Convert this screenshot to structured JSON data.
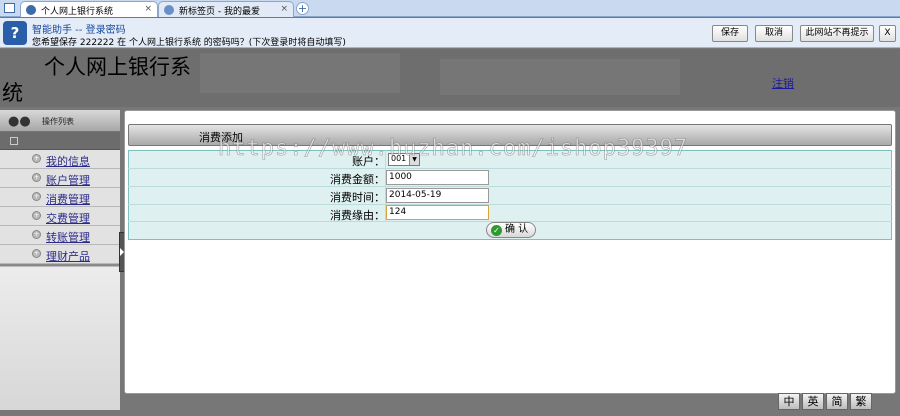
{
  "tabs": [
    {
      "label": "个人网上银行系统",
      "close": "×"
    },
    {
      "label": "新标签页 - 我的最爱",
      "close": "×"
    }
  ],
  "newtab": "+",
  "infobar": {
    "title": "智能助手 -- 登录密码",
    "message": "您希望保存 222222 在 个人网上银行系统 的密码吗？(下次登录时将自动填写)",
    "buttons": {
      "save": "保存",
      "cancel": "取消",
      "never": "此网站不再提示",
      "close": "X"
    }
  },
  "header": {
    "title_line1": "个人网上银行系",
    "title_line2": "统",
    "logout": "注销"
  },
  "sidebar": {
    "header": "操作列表",
    "items": [
      {
        "label": "我的信息"
      },
      {
        "label": "账户管理"
      },
      {
        "label": "消费管理"
      },
      {
        "label": "交费管理"
      },
      {
        "label": "转账管理"
      },
      {
        "label": "理财产品"
      }
    ]
  },
  "panel": {
    "title": "消费添加"
  },
  "form": {
    "account_label": "账户：",
    "account_value": "001",
    "amount_label": "消费金额：",
    "amount_value": "1000",
    "time_label": "消费时间：",
    "time_value": "2014-05-19",
    "reason_label": "消费缘由：",
    "reason_value": "124",
    "confirm": "确 认"
  },
  "watermark": "https://www.huzhan.com/ishop39397",
  "lang": [
    "中",
    "英",
    "简",
    "繁"
  ]
}
